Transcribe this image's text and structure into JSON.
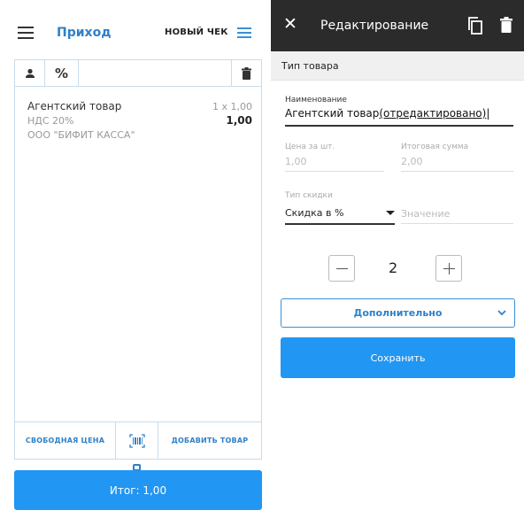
{
  "left": {
    "title": "Приход",
    "new_check_label": "НОВЫЙ ЧЕК",
    "toolbar": {
      "percent_symbol": "%"
    },
    "item": {
      "name": "Агентский товар",
      "qty_price": "1 x 1,00",
      "tax": "НДС 20%",
      "sum": "1,00",
      "org": "ООО \"БИФИТ КАССА\""
    },
    "bottom": {
      "free_price_label": "СВОБОДНАЯ ЦЕНА",
      "add_item_label": "ДОБАВИТЬ ТОВАР"
    },
    "total_label": "Итог: 1,00",
    "accent_color": "#2196f3"
  },
  "right": {
    "title": "Редактирование",
    "type_section": "Тип товара",
    "name_label": "Наименование",
    "name_value_plain": "Агентский товар",
    "name_value_underlined": "(отредактировано)",
    "price_label": "Цена за шт.",
    "price_value": "1,00",
    "sum_label": "Итоговая сумма",
    "sum_value": "2,00",
    "discount_type_label": "Тип скидки",
    "discount_type_value": "Скидка в %",
    "discount_value_placeholder": "Значение",
    "quantity": "2",
    "more_label": "Дополнительно",
    "save_label": "Сохранить",
    "header_color": "#2b2b2b"
  },
  "icons": [
    "menu-icon",
    "list-icon",
    "user-icon",
    "trash-icon",
    "barcode-icon",
    "close-icon",
    "copy-icon",
    "chevron-down-icon"
  ]
}
